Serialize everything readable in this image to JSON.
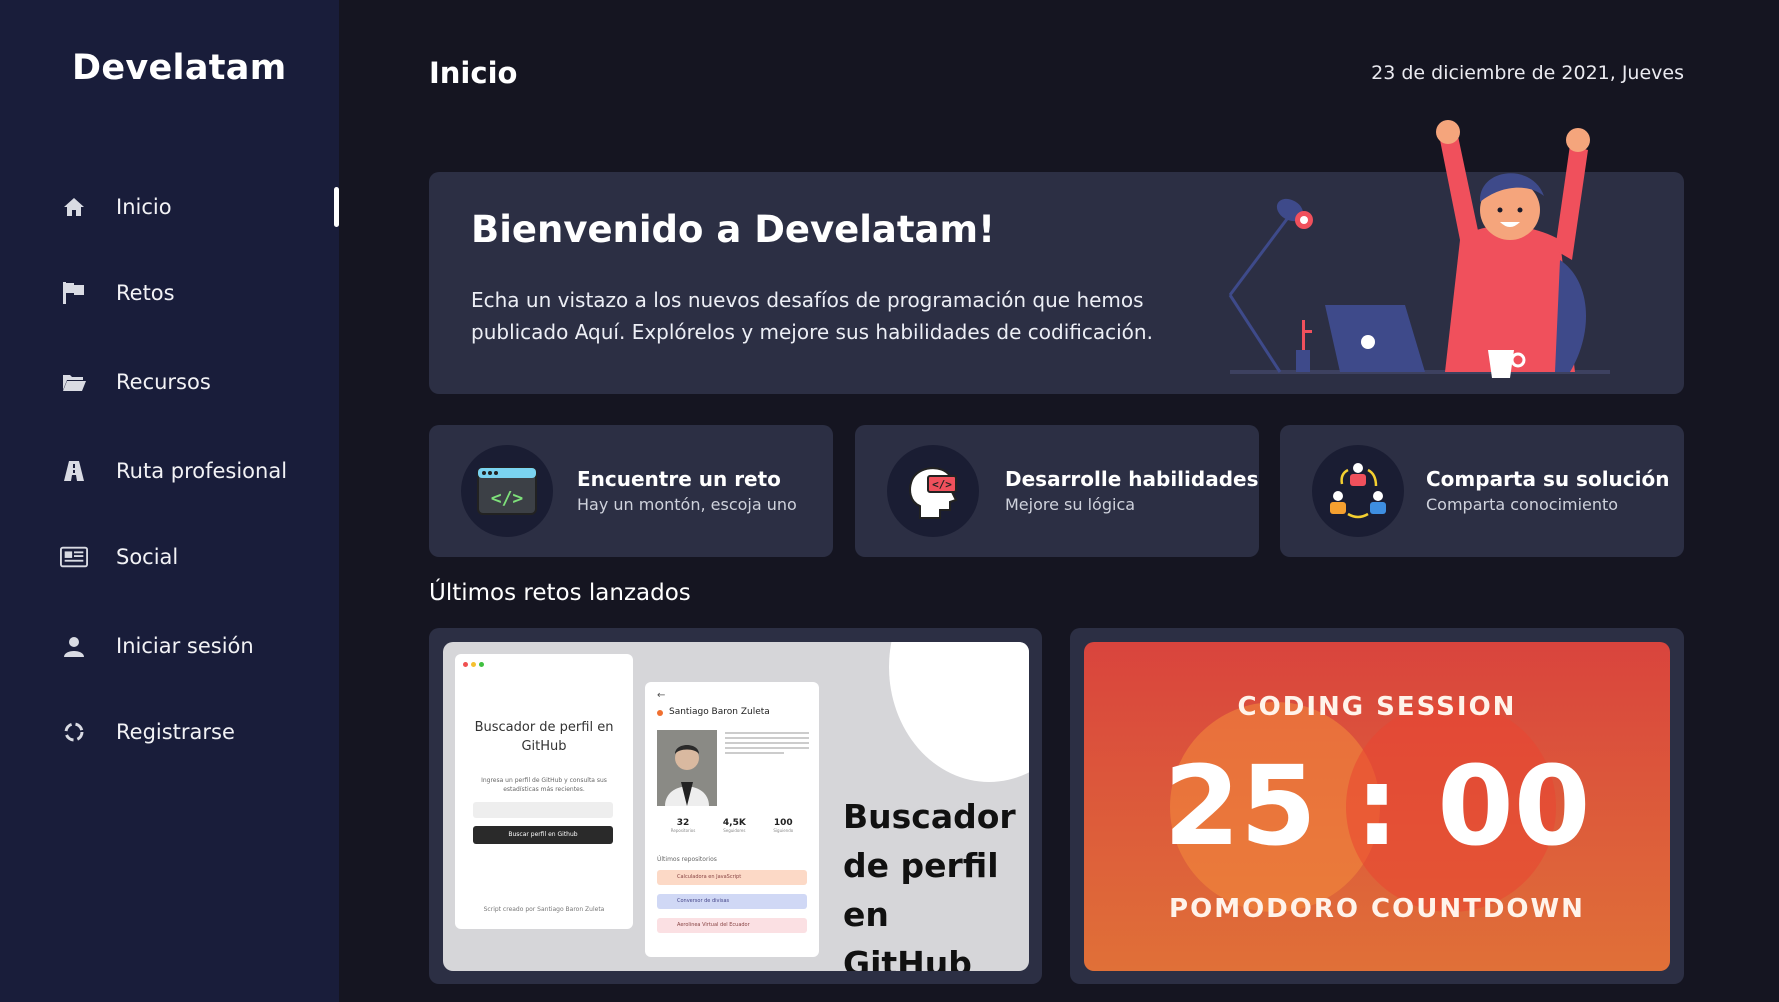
{
  "app": {
    "brand": "Develatam"
  },
  "sidebar": {
    "items": [
      {
        "label": "Inicio",
        "icon": "home-icon",
        "active": true
      },
      {
        "label": "Retos",
        "icon": "flag-icon",
        "active": false
      },
      {
        "label": "Recursos",
        "icon": "folder-icon",
        "active": false
      },
      {
        "label": "Ruta profesional",
        "icon": "road-icon",
        "active": false
      },
      {
        "label": "Social",
        "icon": "newspaper-icon",
        "active": false
      },
      {
        "label": "Iniciar sesión",
        "icon": "user-icon",
        "active": false
      },
      {
        "label": "Registrarse",
        "icon": "circle-notch-icon",
        "active": false
      }
    ]
  },
  "header": {
    "title": "Inicio",
    "date": "23 de diciembre de 2021, Jueves"
  },
  "welcome": {
    "title": "Bienvenido a Develatam!",
    "text": "Echa un vistazo a los nuevos desafíos de programación que hemos publicado Aquí. Explórelos y mejore sus habilidades de codificación."
  },
  "features": [
    {
      "title": "Encuentre un reto",
      "subtitle": "Hay un montón, escoja uno",
      "icon": "code-window-icon"
    },
    {
      "title": "Desarrolle habilidades",
      "subtitle": "Mejore su lógica",
      "icon": "head-code-icon"
    },
    {
      "title": "Comparta su solución",
      "subtitle": "Comparta conocimiento",
      "icon": "share-people-icon"
    }
  ],
  "latest": {
    "title": "Últimos retos lanzados",
    "cards": [
      {
        "big_title_lines": [
          "Buscador",
          "de perfil",
          "en GitHub"
        ],
        "left_title": "Buscador de perfil en GitHub",
        "left_desc": "Ingresa un perfil de GitHub y consulta sus estadísticas más recientes.",
        "left_button": "Buscar perfil en Github",
        "left_footer": "Script creado por Santiago Baron Zuleta",
        "profile_name": "Santiago Baron Zuleta",
        "stats": [
          {
            "value": "32",
            "label": "Repositorios"
          },
          {
            "value": "4,5K",
            "label": "Seguidores"
          },
          {
            "value": "100",
            "label": "Siguiendo"
          }
        ],
        "repos_title": "Últimos repositorios",
        "repos": [
          "Calculadora en JavaScript",
          "Conversor de divisas",
          "Aerolinea Virtual del Ecuador"
        ]
      },
      {
        "top": "CODING SESSION",
        "time": "25 : 00",
        "bottom": "POMODORO COUNTDOWN"
      }
    ]
  },
  "colors": {
    "background": "#151521",
    "sidebar": "#191d3a",
    "card": "#2c2f44",
    "accent": "#f0505c"
  }
}
